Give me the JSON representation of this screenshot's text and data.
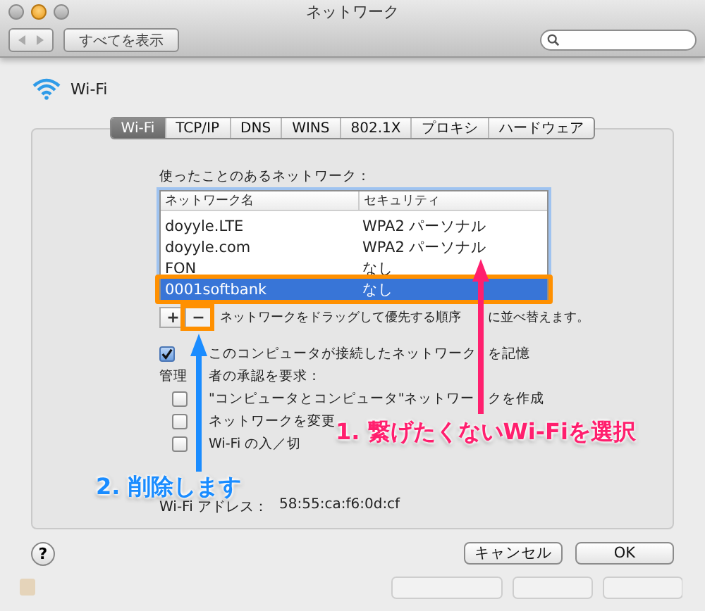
{
  "window": {
    "title": "ネットワーク"
  },
  "toolbar": {
    "show_all_button": "すべてを表示"
  },
  "service": {
    "name": "Wi-Fi"
  },
  "tabs": [
    {
      "label": "Wi-Fi",
      "selected": true
    },
    {
      "label": "TCP/IP",
      "selected": false
    },
    {
      "label": "DNS",
      "selected": false
    },
    {
      "label": "WINS",
      "selected": false
    },
    {
      "label": "802.1X",
      "selected": false
    },
    {
      "label": "プロキシ",
      "selected": false
    },
    {
      "label": "ハードウェア",
      "selected": false
    }
  ],
  "networks": {
    "label": "使ったことのあるネットワーク：",
    "columns": [
      "ネットワーク名",
      "セキュリティ"
    ],
    "rows": [
      {
        "name": "doyyle.LTE",
        "security": "WPA2 パーソナル",
        "selected": false
      },
      {
        "name": "doyyle.com",
        "security": "WPA2 パーソナル",
        "selected": false
      },
      {
        "name": "FON",
        "security": "なし",
        "selected": false
      },
      {
        "name": "0001softbank",
        "security": "なし",
        "selected": true
      }
    ],
    "add_button": "+",
    "remove_button": "−",
    "hint_parts": [
      "ネットワークをドラッグして優先する順序",
      "に並べ替えます。"
    ]
  },
  "remember": {
    "label_parts": [
      "このコンピュータが接続したネットワーク",
      "を記憶"
    ],
    "checked": true
  },
  "admin": {
    "label_parts": [
      "管理",
      "者の承認を要求："
    ],
    "options": [
      {
        "label_parts": [
          "\"コンピュータとコンピュータ\"ネットワー",
          "クを作成"
        ],
        "checked": false
      },
      {
        "label_parts": [
          "ネットワークを変更"
        ],
        "checked": false
      },
      {
        "label_parts": [
          "Wi-Fi の入／切"
        ],
        "checked": false
      }
    ]
  },
  "address": {
    "label": "Wi-Fi アドレス：",
    "value": "58:55:ca:f6:0d:cf"
  },
  "help_button": "?",
  "buttons": [
    "キャンセル",
    "OK"
  ],
  "annotations": [
    {
      "text": "1. 繋げたくないWi-Fiを選択",
      "color": "#ff1f6e"
    },
    {
      "text": "2. 削除します",
      "color": "#1a8cff"
    }
  ]
}
